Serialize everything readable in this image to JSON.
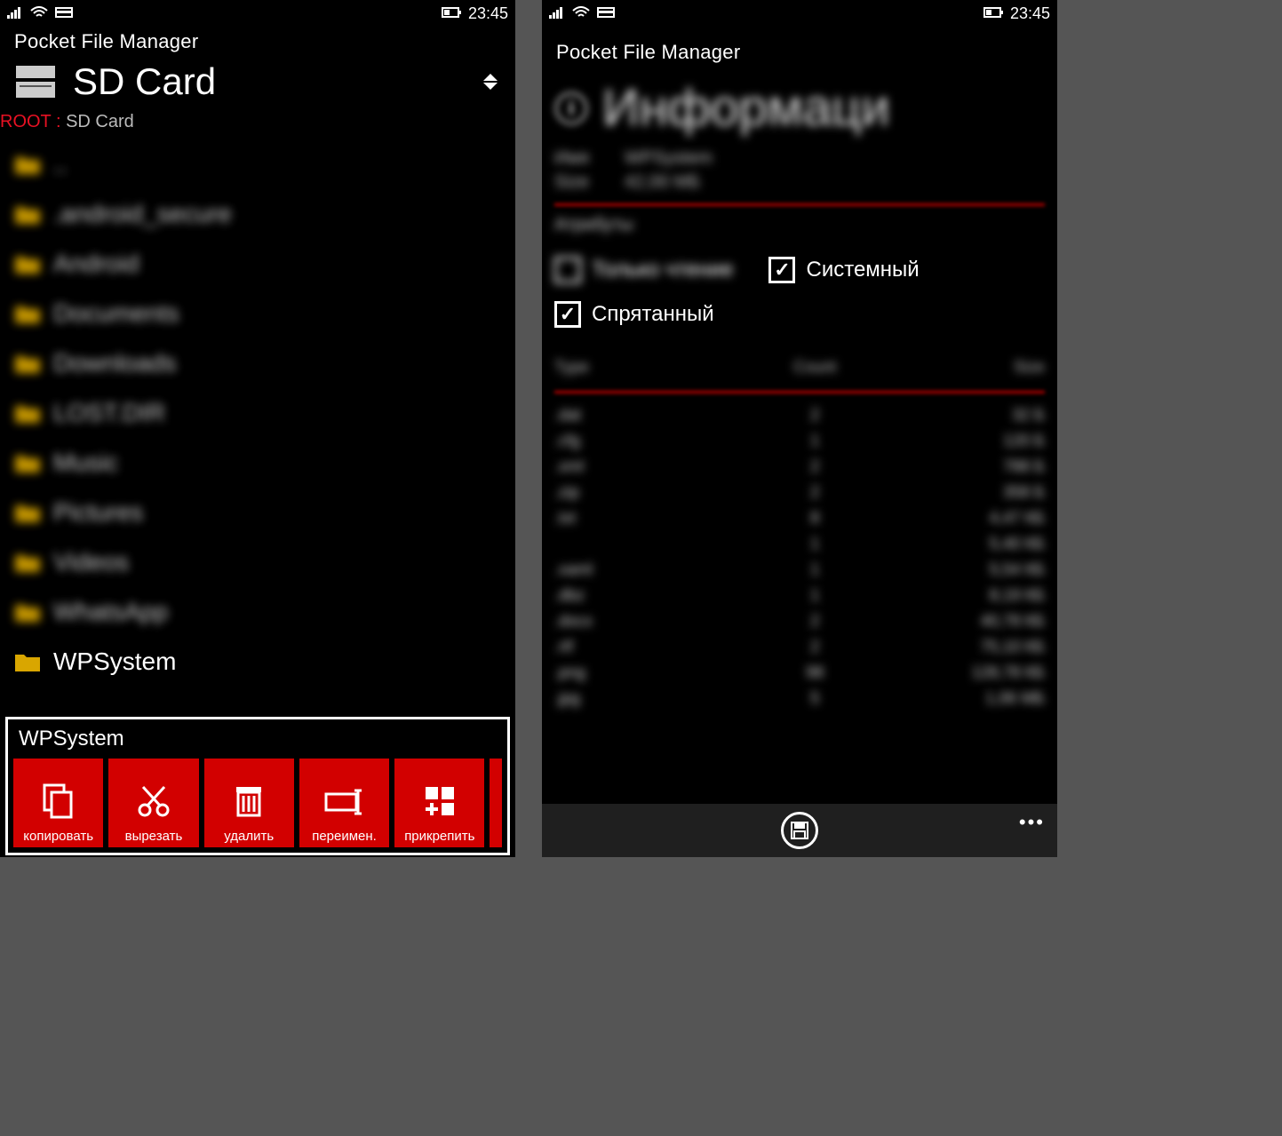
{
  "statusbar": {
    "time": "23:45"
  },
  "app": {
    "title": "Pocket File Manager"
  },
  "left": {
    "location_title": "SD Card",
    "breadcrumb": {
      "root": "ROOT",
      "sep": " : ",
      "path": "SD Card"
    },
    "files": [
      {
        "name": "..",
        "blurred": true,
        "up": true
      },
      {
        "name": ".android_secure",
        "blurred": true
      },
      {
        "name": "Android",
        "blurred": true
      },
      {
        "name": "Documents",
        "blurred": true
      },
      {
        "name": "Downloads",
        "blurred": true
      },
      {
        "name": "LOST.DIR",
        "blurred": true
      },
      {
        "name": "Music",
        "blurred": true
      },
      {
        "name": "Pictures",
        "blurred": true
      },
      {
        "name": "Videos",
        "blurred": true
      },
      {
        "name": "WhatsApp",
        "blurred": true
      },
      {
        "name": "WPSystem",
        "blurred": false,
        "selected": true
      }
    ],
    "context": {
      "title": "WPSystem",
      "actions": [
        {
          "label": "копировать",
          "icon": "copy"
        },
        {
          "label": "вырезать",
          "icon": "cut"
        },
        {
          "label": "удалить",
          "icon": "delete"
        },
        {
          "label": "переимен.",
          "icon": "rename"
        },
        {
          "label": "прикрепить",
          "icon": "pin"
        }
      ]
    }
  },
  "right": {
    "info_title": "Информаци",
    "kv": [
      {
        "k": "Имя",
        "v": "WPSystem"
      },
      {
        "k": "Size",
        "v": "42,00 МБ"
      }
    ],
    "attrs_header": "Атрибуты",
    "attrs": [
      {
        "label": "Только чтение",
        "checked": false,
        "blurred": true
      },
      {
        "label": "Системный",
        "checked": true,
        "blurred": false
      },
      {
        "label": "Спрятанный",
        "checked": true,
        "blurred": false
      }
    ],
    "table": {
      "head": {
        "c1": "Type",
        "c2": "Count",
        "c3": "Size"
      },
      "rows": [
        {
          "c1": ".dat",
          "c2": "2",
          "c3": "32 Б"
        },
        {
          "c1": ".cfg",
          "c2": "1",
          "c3": "120 Б"
        },
        {
          "c1": ".xml",
          "c2": "2",
          "c3": "788 Б"
        },
        {
          "c1": ".zip",
          "c2": "2",
          "c3": "358 Б"
        },
        {
          "c1": ".txt",
          "c2": "8",
          "c3": "4,47 КБ"
        },
        {
          "c1": "",
          "c2": "1",
          "c3": "5,40 КБ"
        },
        {
          "c1": ".xaml",
          "c2": "1",
          "c3": "5,54 КБ"
        },
        {
          "c1": ".dbz",
          "c2": "1",
          "c3": "8,19 КБ"
        },
        {
          "c1": ".docx",
          "c2": "2",
          "c3": "40,78 КБ"
        },
        {
          "c1": ".rtf",
          "c2": "2",
          "c3": "75,10 КБ"
        },
        {
          "c1": ".png",
          "c2": "98",
          "c3": "128,78 КБ"
        },
        {
          "c1": ".jpg",
          "c2": "5",
          "c3": "1,06 МБ"
        }
      ]
    },
    "appbar": {
      "more": "•••"
    }
  }
}
